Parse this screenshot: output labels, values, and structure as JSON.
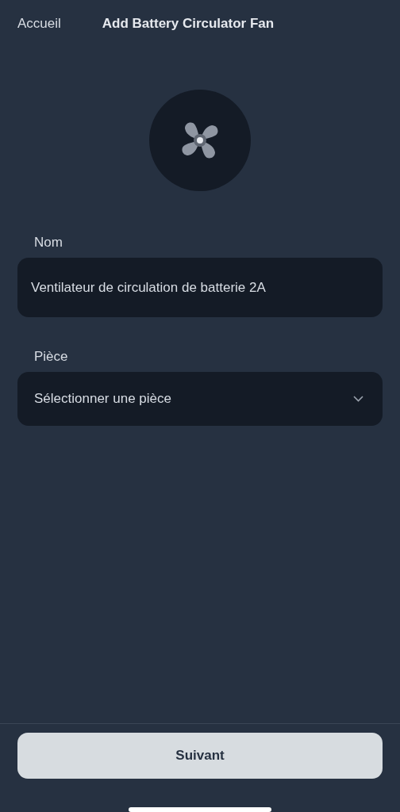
{
  "nav": {
    "back": "Accueil",
    "title": "Add Battery Circulator Fan"
  },
  "fields": [
    {
      "kind": "text",
      "label": "Nom",
      "value": "Ventilateur de circulation de batterie 2A"
    },
    {
      "kind": "select",
      "label": "Pièce",
      "placeholder": "Sélectionner une pièce"
    }
  ],
  "button": {
    "label": "Suivant"
  }
}
